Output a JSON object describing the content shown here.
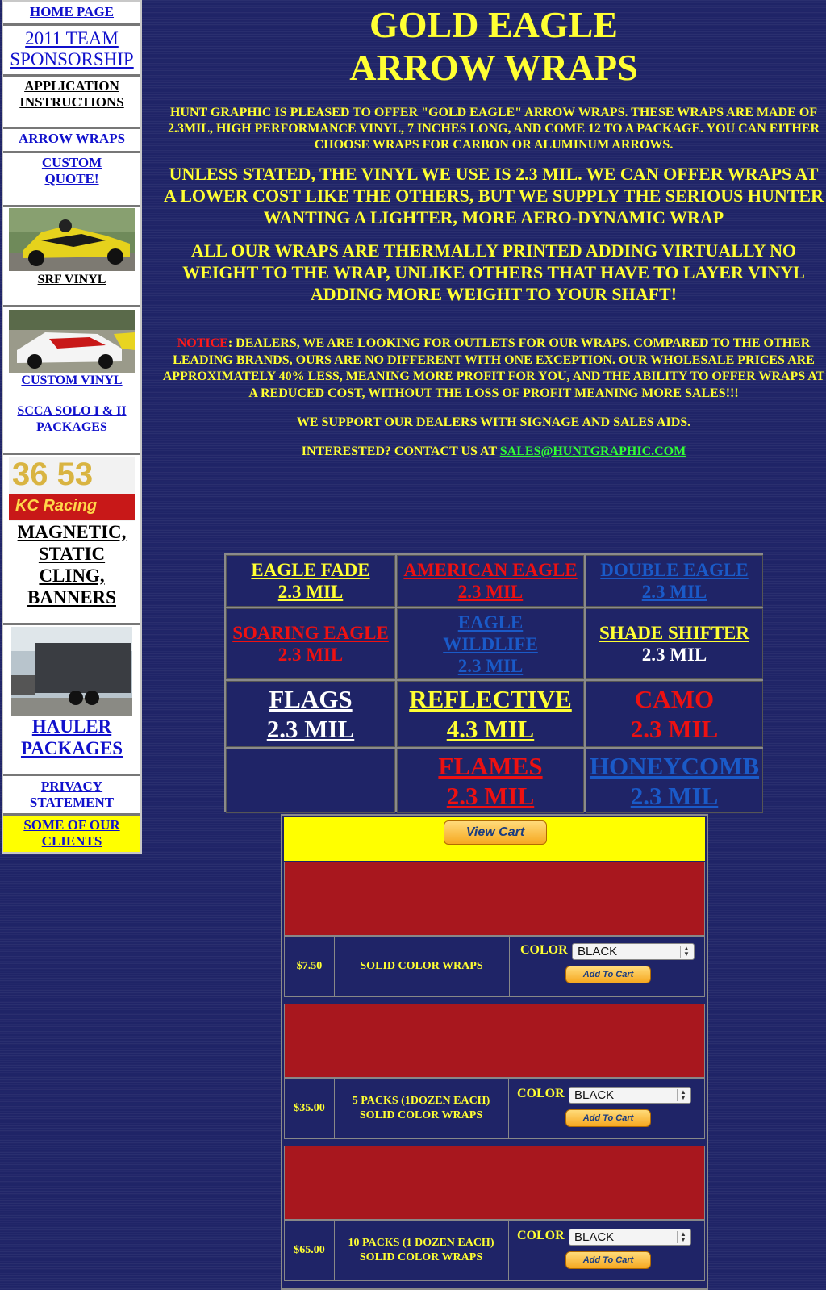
{
  "sidebar": {
    "home": "HOME PAGE",
    "sponsorship": "2011 TEAM SPONSORSHIP",
    "application": "APPLICATION INSTRUCTIONS",
    "arrow_wraps": "ARROW WRAPS",
    "custom_quote": "CUSTOM QUOTE!",
    "srf_vinyl": "SRF VINYL",
    "custom_vinyl": "CUSTOM VINYL",
    "scca": "SCCA SOLO I & II PACKAGES",
    "magnetic": "MAGNETIC, STATIC CLING, BANNERS",
    "magnetic_photo_numbers": "36 53",
    "magnetic_photo_brand": "KC Racing",
    "hauler": "HAULER PACKAGES",
    "privacy": "PRIVACY STATEMENT",
    "clients": "SOME OF OUR CLIENTS"
  },
  "main": {
    "title_line1": "GOLD EAGLE",
    "title_line2": "ARROW WRAPS",
    "intro": "HUNT GRAPHIC IS PLEASED TO OFFER \"GOLD EAGLE\" ARROW WRAPS. THESE WRAPS ARE MADE OF 2.3MIL, HIGH PERFORMANCE VINYL, 7 INCHES LONG, AND COME 12 TO A PACKAGE. YOU CAN EITHER CHOOSE WRAPS FOR CARBON OR ALUMINUM ARROWS.",
    "vinyl_note": "UNLESS STATED, THE VINYL WE USE IS 2.3 MIL. WE CAN OFFER WRAPS AT A LOWER COST LIKE THE OTHERS, BUT WE SUPPLY THE SERIOUS HUNTER WANTING A LIGHTER, MORE AERO-DYNAMIC WRAP",
    "thermal_note": "ALL OUR WRAPS ARE THERMALLY PRINTED ADDING VIRTUALLY NO WEIGHT TO THE WRAP, UNLIKE OTHERS THAT HAVE TO LAYER VINYL ADDING MORE WEIGHT TO YOUR SHAFT!",
    "notice_label": "NOTICE",
    "notice_text": ": DEALERS, WE ARE LOOKING FOR OUTLETS FOR OUR WRAPS. COMPARED TO THE OTHER LEADING BRANDS, OURS ARE NO DIFFERENT WITH ONE EXCEPTION. OUR WHOLESALE PRICES ARE APPROXIMATELY 40% LESS, MEANING MORE PROFIT FOR YOU, AND THE ABILITY TO OFFER WRAPS AT A REDUCED COST, WITHOUT THE LOSS OF PROFIT MEANING MORE SALES!!!",
    "support": "WE SUPPORT OUR DEALERS WITH SIGNAGE AND SALES AIDS.",
    "interested": "INTERESTED? CONTACT US AT ",
    "email": "SALES@HUNTGRAPHIC.COM"
  },
  "grid": {
    "eagle_fade": "EAGLE FADE",
    "eagle_fade_mil": "2.3 MIL",
    "american_eagle": "AMERICAN EAGLE",
    "american_eagle_mil": "2.3 MIL",
    "double_eagle": "DOUBLE EAGLE",
    "double_eagle_mil": "2.3 MIL",
    "soaring_eagle": "SOARING EAGLE",
    "soaring_eagle_mil": "2.3 MIL",
    "eagle_wildlife": "EAGLE WILDLIFE",
    "eagle_wildlife_mil": "2.3 MIL",
    "shade_shifter": "SHADE SHIFTER",
    "shade_shifter_mil": "2.3 MIL",
    "flags": "FLAGS",
    "flags_mil": "2.3 MIL",
    "reflective": "REFLECTIVE",
    "reflective_mil": "4.3 MIL",
    "camo": "CAMO",
    "camo_mil": "2.3 MIL",
    "flames": "FLAMES",
    "flames_mil": "2.3 MIL",
    "honeycomb": "HONEYCOMB",
    "honeycomb_mil": "2.3 MIL"
  },
  "cart": {
    "view_cart": "View Cart",
    "color_label": "COLOR",
    "add_to_cart": "Add To Cart",
    "products": [
      {
        "price": "$7.50",
        "desc": "SOLID COLOR WRAPS",
        "color": "BLACK"
      },
      {
        "price": "$35.00",
        "desc": "5 PACKS (1DOZEN EACH) SOLID COLOR WRAPS",
        "color": "BLACK"
      },
      {
        "price": "$65.00",
        "desc": "10 PACKS (1 DOZEN EACH) SOLID COLOR WRAPS",
        "color": "BLACK"
      }
    ]
  }
}
